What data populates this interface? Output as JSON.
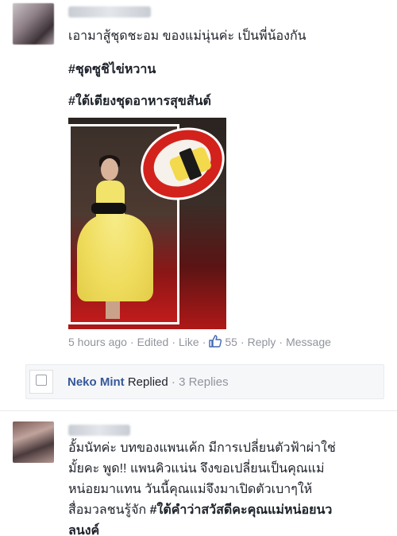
{
  "comment1": {
    "author_name": "",
    "lines": [
      "เอามาสู้ชุดชะอม ของแม่นุ่นค่ะ  เป็นพี่น้องกัน",
      "#ชุดซูชิไข่หวาน",
      "#ใต้เตียงชุดอาหารสุขสันต์"
    ],
    "meta": {
      "time": "5 hours ago",
      "edited": "Edited",
      "like": "Like",
      "like_count": "55",
      "reply": "Reply",
      "message": "Message"
    }
  },
  "reply_bar": {
    "name": "Neko Mint",
    "action": "Replied",
    "count_label": "3 Replies"
  },
  "comment2": {
    "author_name": "",
    "lines": [
      "อั้มนัทค่ะ  บทของแพนเค้ก มีการเปลี่ยนตัวฟ้าผ่าใช่",
      "มั้ยคะ พูด!! แพนคิวแน่น จึงขอเปลี่ยนเป็นคุณแม่",
      "หน่อยมาแทน วันนี้คุณแม่จึงมาเปิดตัวเบาๆให้",
      "สื่อมวลชนรู้จัก ",
      "#ใต้คำว่าสวัสดีคะคุณแม่หน่อยนว",
      "ลนงค์"
    ]
  },
  "colors": {
    "text": "#1d2129",
    "meta": "#90949c",
    "link_blue": "#365899",
    "like_blue": "#4267b2"
  },
  "icons": [
    "thumbs-up-icon"
  ]
}
